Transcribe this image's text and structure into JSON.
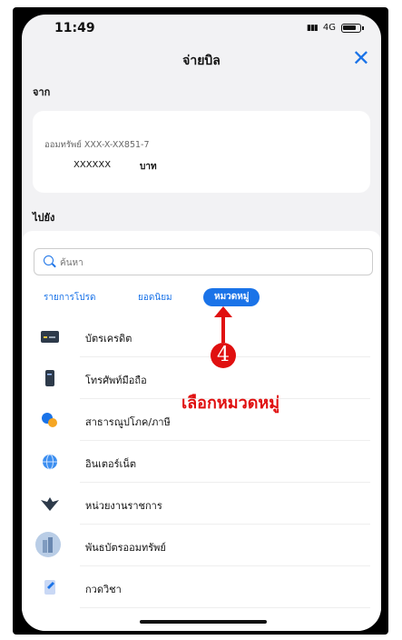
{
  "status_bar": {
    "time": "11:49",
    "network": "4G"
  },
  "header": {
    "title": "จ่ายบิล",
    "close_icon": "close-icon"
  },
  "from": {
    "label": "จาก",
    "account_number": "ออมทรัพย์ XXX-X-XX851-7",
    "balance": "XXXXXX",
    "currency": "บาท"
  },
  "to": {
    "label": "ไปยัง"
  },
  "search": {
    "placeholder": "ค้นหา"
  },
  "tabs": [
    {
      "label": "รายการโปรด",
      "active": false
    },
    {
      "label": "ยอดนิยม",
      "active": false
    },
    {
      "label": "หมวดหมู่",
      "active": true
    }
  ],
  "categories": [
    {
      "label": "บัตรเครดิต",
      "icon": "credit-card-icon"
    },
    {
      "label": "โทรศัพท์มือถือ",
      "icon": "mobile-phone-icon"
    },
    {
      "label": "สาธารณูปโภค/ภาษี",
      "icon": "utilities-icon"
    },
    {
      "label": "อินเตอร์เน็ต",
      "icon": "globe-icon"
    },
    {
      "label": "หน่วยงานราชการ",
      "icon": "government-emblem-icon"
    },
    {
      "label": "พันธบัตรออมทรัพย์",
      "icon": "bond-building-icon"
    },
    {
      "label": "กวดวิชา",
      "icon": "tutoring-icon"
    }
  ],
  "annotation": {
    "step_number": "4",
    "text": "เลือกหมวดหมู่"
  },
  "colors": {
    "accent": "#1a73e8",
    "annotation": "#e01010"
  }
}
